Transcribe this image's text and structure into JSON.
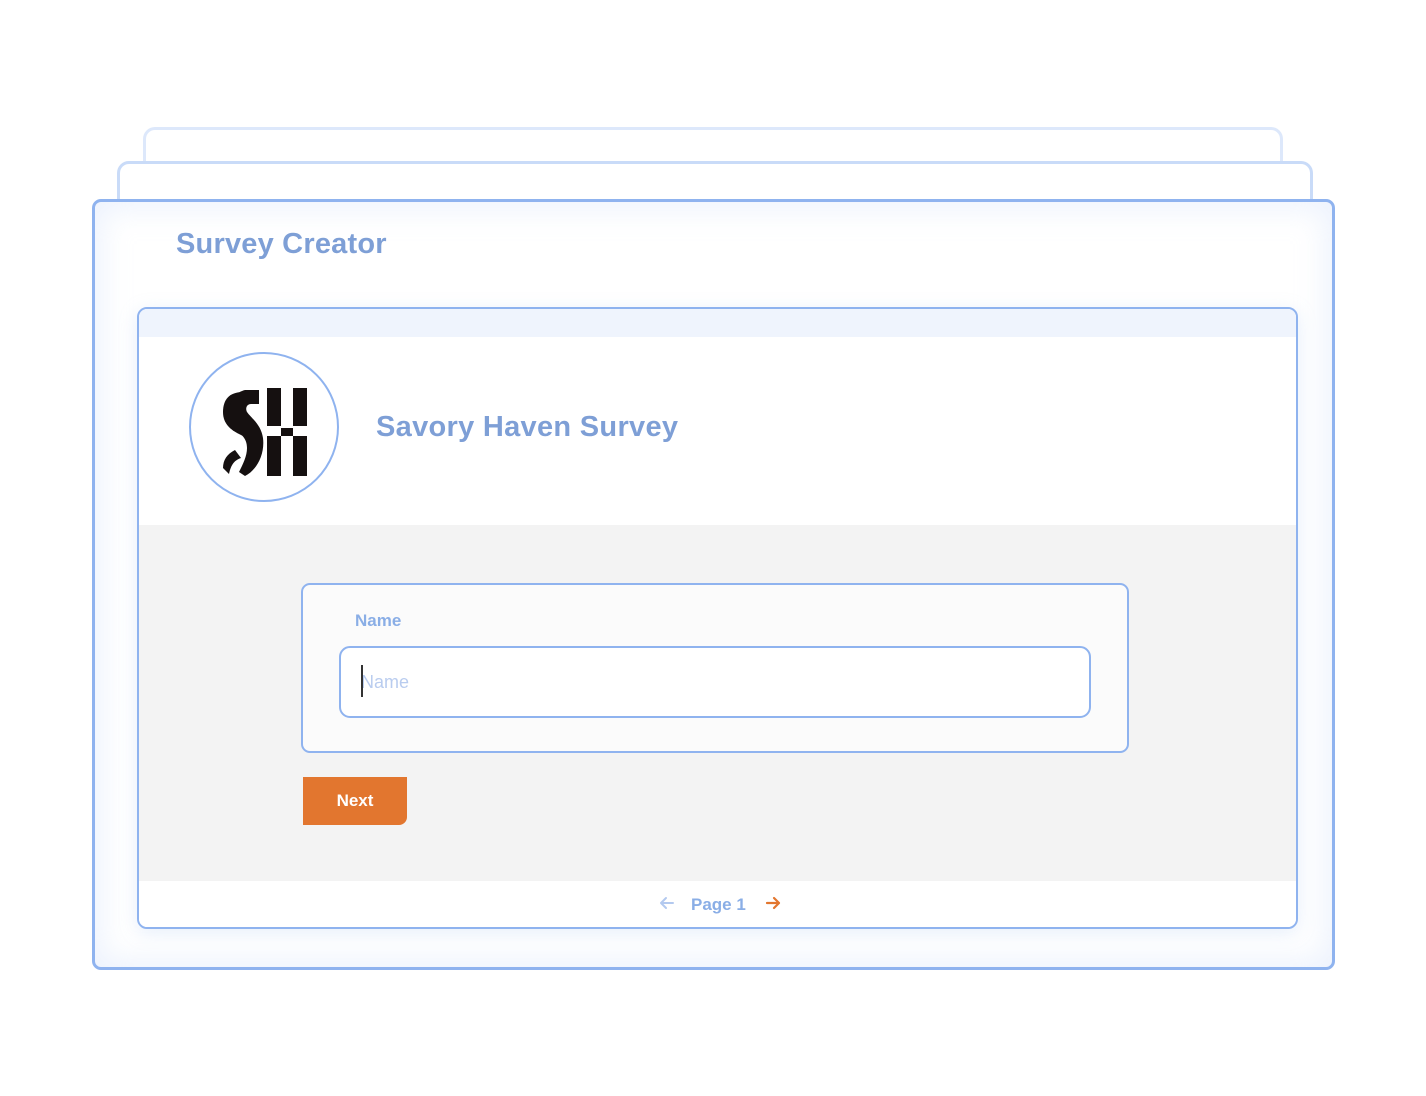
{
  "app": {
    "title": "Survey Creator"
  },
  "survey": {
    "title": "Savory Haven Survey",
    "logo": {
      "icon": "sh-monogram-logo",
      "text": "SH"
    }
  },
  "question": {
    "label": "Name",
    "input": {
      "value": "",
      "placeholder": "Name"
    }
  },
  "navigation": {
    "next_label": "Next",
    "page_label": "Page 1",
    "prev_icon": "arrow-left-icon",
    "next_icon": "arrow-right-icon"
  },
  "colors": {
    "accent": "#e2762f",
    "primary_text": "#7e9fd6",
    "border": "#8fb3ef",
    "body_background": "#f3f3f3"
  }
}
